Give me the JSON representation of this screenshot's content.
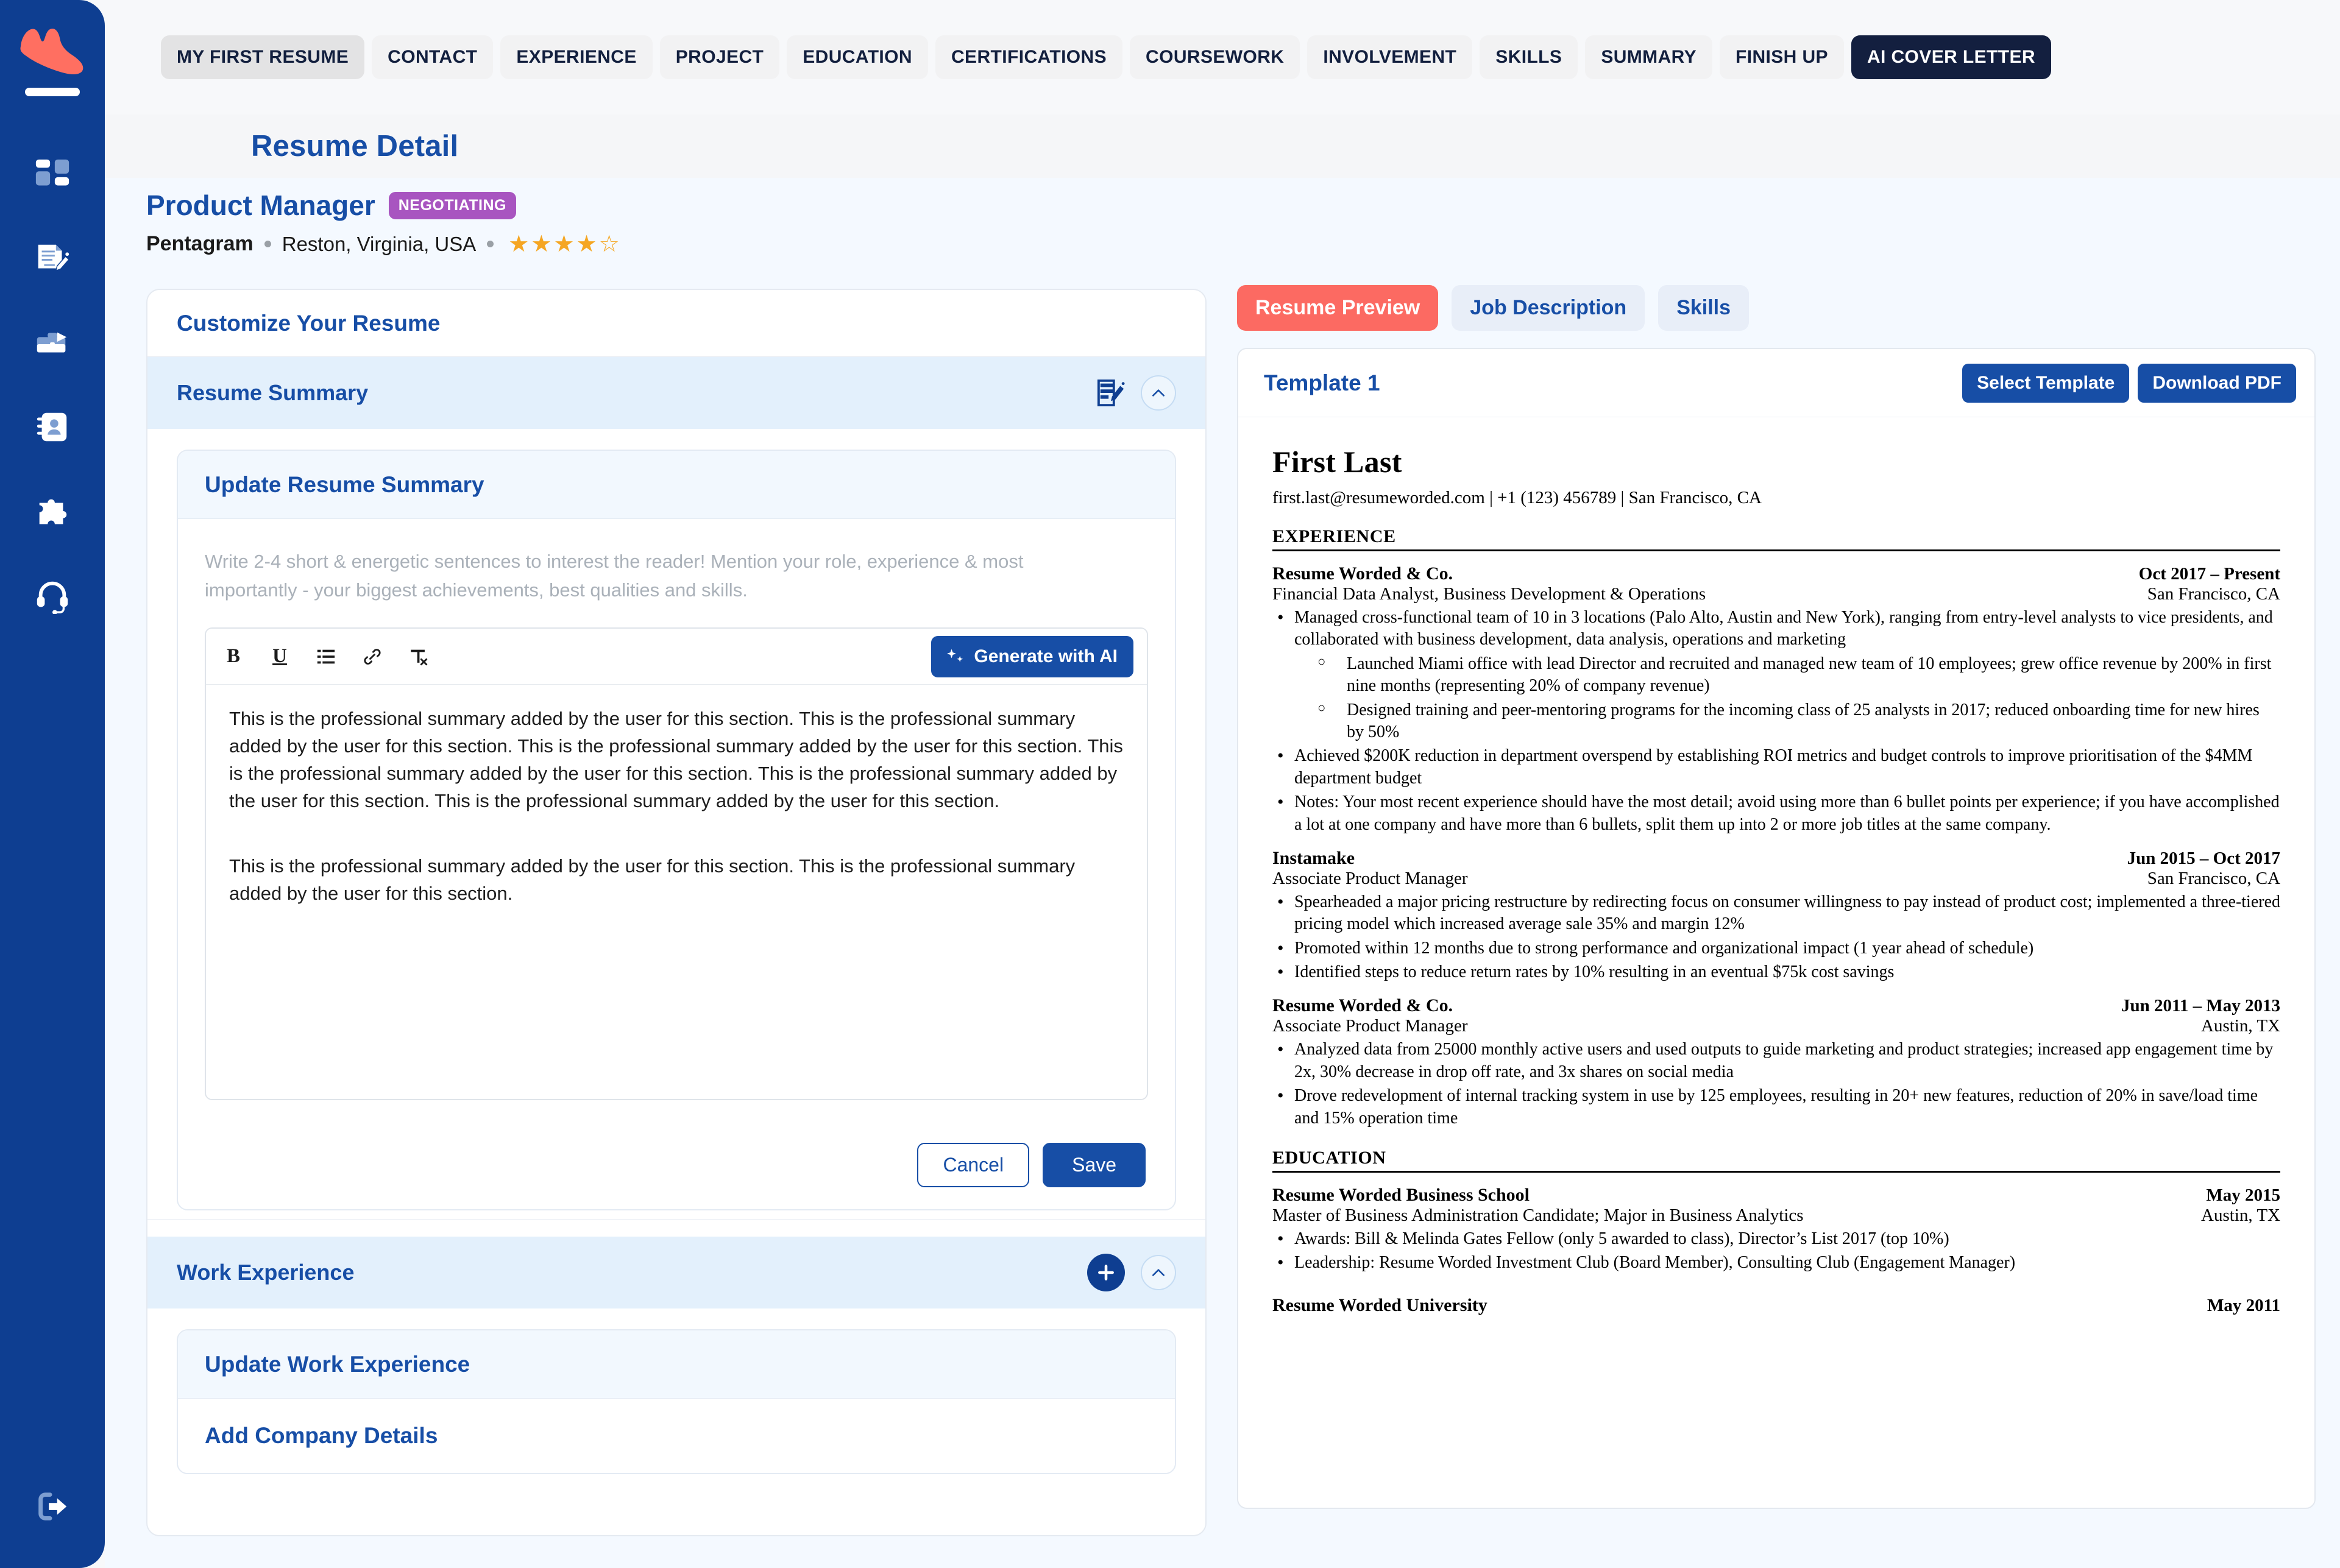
{
  "sidebar": {
    "logo_name": "brand-logo",
    "items": [
      {
        "name": "dashboard",
        "icon": "dashboard-icon"
      },
      {
        "name": "resume-builder",
        "icon": "document-edit-icon"
      },
      {
        "name": "jobs",
        "icon": "briefcase-icon"
      },
      {
        "name": "contacts",
        "icon": "contact-book-icon"
      },
      {
        "name": "integrations",
        "icon": "puzzle-icon"
      },
      {
        "name": "support",
        "icon": "headset-icon"
      }
    ],
    "logout": {
      "name": "logout",
      "icon": "logout-icon"
    }
  },
  "topnav": {
    "tabs": [
      {
        "label": "MY FIRST RESUME",
        "style": "active-grey"
      },
      {
        "label": "CONTACT",
        "style": "grey"
      },
      {
        "label": "EXPERIENCE",
        "style": "grey"
      },
      {
        "label": "PROJECT",
        "style": "grey"
      },
      {
        "label": "EDUCATION",
        "style": "grey"
      },
      {
        "label": "CERTIFICATIONS",
        "style": "grey"
      },
      {
        "label": "COURSEWORK",
        "style": "grey"
      },
      {
        "label": "INVOLVEMENT",
        "style": "grey"
      },
      {
        "label": "SKILLS",
        "style": "grey"
      },
      {
        "label": "SUMMARY",
        "style": "grey"
      },
      {
        "label": "FINISH UP",
        "style": "grey"
      },
      {
        "label": "AI COVER LETTER",
        "style": "dark"
      }
    ]
  },
  "page": {
    "title": "Resume Detail"
  },
  "job": {
    "title": "Product Manager",
    "status": "NEGOTIATING",
    "company": "Pentagram",
    "location": "Reston, Virginia, USA",
    "rating": 4,
    "rating_max": 5
  },
  "customize": {
    "heading": "Customize Your Resume",
    "summary_section": {
      "title": "Resume Summary",
      "edit_icon": "edit-pencil-icon",
      "collapse_icon": "chevron-up-icon",
      "form_title": "Update Resume Summary",
      "hint": "Write 2-4 short & energetic sentences to interest the reader! Mention your role, experience & most importantly - your biggest achievements, best qualities and skills.",
      "toolbar": {
        "bold": "B",
        "underline": "U",
        "list": "bullet-list-icon",
        "link": "link-icon",
        "clear_format": "clear-formatting-icon",
        "generate_ai": "Generate with AI"
      },
      "content_paragraphs": [
        "This is the professional summary added by the user for this section. This is the professional summary added by the user for this section. This is the professional summary added by the user for this section. This is the professional summary added by the user for this section. This is the professional summary added by the user for this section. This is the professional summary added by the user for this section.",
        "This is the professional summary added by the user for this section. This is the professional summary added by the user for this section."
      ],
      "cancel_label": "Cancel",
      "save_label": "Save"
    },
    "work_section": {
      "title": "Work Experience",
      "add_icon": "plus-icon",
      "collapse_icon": "chevron-up-icon",
      "form_title": "Update Work Experience",
      "subsection_title": "Add Company Details"
    }
  },
  "preview": {
    "tabs": [
      {
        "label": "Resume Preview",
        "selected": true
      },
      {
        "label": "Job Description",
        "selected": false
      },
      {
        "label": "Skills",
        "selected": false
      }
    ],
    "template_name": "Template 1",
    "select_template_label": "Select Template",
    "download_pdf_label": "Download PDF",
    "colors": {
      "accent_red": "#fc6a62",
      "brand_blue": "#174ea6",
      "sidebar_blue": "#0e3e91",
      "status_purple": "#a855c0"
    }
  },
  "resume": {
    "name": "First Last",
    "contact": "first.last@resumeworded.com  |  +1 (123) 456789  |  San Francisco, CA",
    "experience_heading": "EXPERIENCE",
    "experience": [
      {
        "org": "Resume Worded & Co.",
        "date": "Oct 2017 – Present",
        "role": "Financial Data Analyst, Business Development & Operations",
        "location": "San Francisco, CA",
        "bullets": [
          {
            "text": "Managed cross-functional team of 10 in 3 locations (Palo Alto, Austin and New York), ranging from entry-level analysts to vice presidents, and collaborated with business development, data analysis, operations and marketing",
            "sub": [
              "Launched Miami office with lead Director and recruited and managed new team of 10 employees; grew office revenue by 200% in first nine months (representing 20% of company revenue)",
              "Designed training and peer-mentoring programs for the incoming class of 25 analysts in 2017; reduced onboarding time for new hires by 50%"
            ]
          },
          {
            "text": "Achieved $200K reduction in department overspend by establishing ROI metrics and budget controls to improve prioritisation of the $4MM department budget",
            "sub": []
          },
          {
            "text": "Notes: Your most recent experience should have the most detail; avoid using more than 6 bullet points per experience; if you have accomplished a lot at one company and have more than 6 bullets, split them up into 2 or more job titles at the same company.",
            "sub": []
          }
        ]
      },
      {
        "org": "Instamake",
        "date": "Jun 2015 – Oct 2017",
        "role": "Associate Product Manager",
        "location": "San Francisco, CA",
        "bullets": [
          {
            "text": "Spearheaded a major pricing restructure by redirecting focus on consumer willingness to pay instead of product cost; implemented a three-tiered pricing model which increased average sale 35% and margin 12%",
            "sub": []
          },
          {
            "text": "Promoted within 12 months due to strong performance and organizational impact (1 year ahead of schedule)",
            "sub": []
          },
          {
            "text": "Identified steps to reduce return rates by 10% resulting in an eventual $75k cost savings",
            "sub": []
          }
        ]
      },
      {
        "org": "Resume Worded & Co.",
        "date": "Jun 2011 – May 2013",
        "role": "Associate Product Manager",
        "location": "Austin, TX",
        "bullets": [
          {
            "text": "Analyzed data from 25000 monthly active users and used outputs to guide marketing and product strategies; increased app engagement time by 2x, 30% decrease in drop off rate, and 3x shares on social media",
            "sub": []
          },
          {
            "text": "Drove redevelopment of internal tracking system in use by 125 employees, resulting in 20+ new features, reduction of 20% in save/load time and 15% operation time",
            "sub": []
          }
        ]
      }
    ],
    "education_heading": "EDUCATION",
    "education": [
      {
        "org": "Resume Worded Business School",
        "date": "May 2015",
        "role": "Master of Business Administration Candidate; Major in Business Analytics",
        "location": "Austin, TX",
        "bullets": [
          "Awards: Bill & Melinda Gates Fellow (only 5 awarded to class), Director’s List 2017 (top 10%)",
          "Leadership: Resume Worded Investment Club (Board Member), Consulting Club (Engagement Manager)"
        ]
      },
      {
        "org": "Resume Worded University",
        "date": "May 2011",
        "role": "",
        "location": "",
        "bullets": []
      }
    ]
  }
}
